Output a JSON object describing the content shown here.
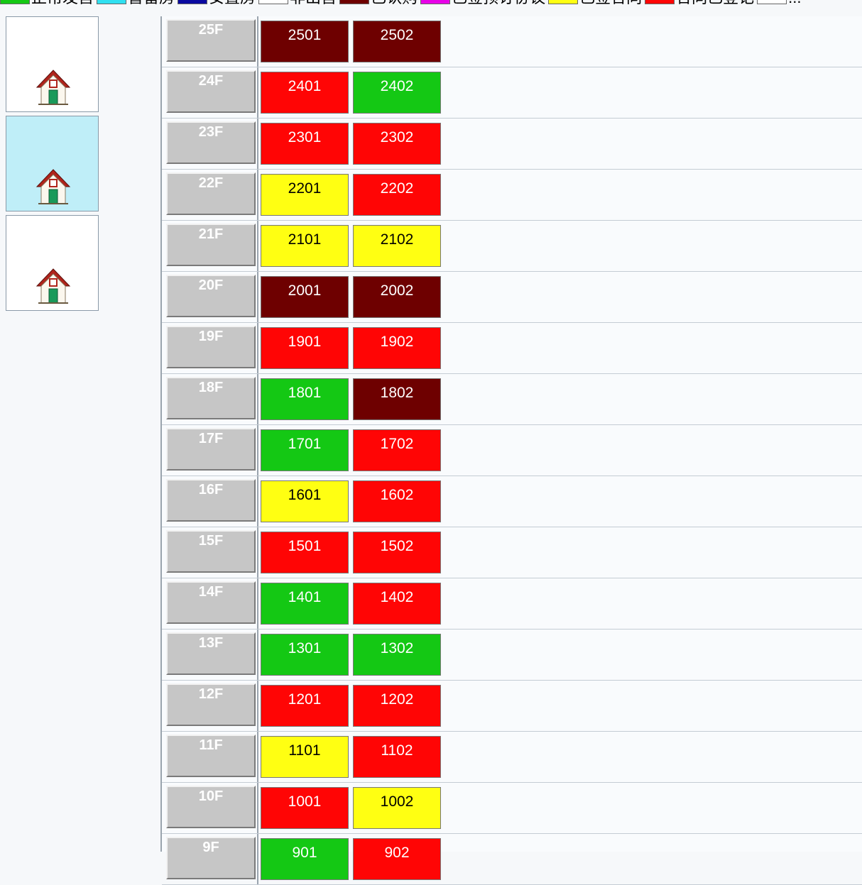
{
  "colors": {
    "maroon": "#6e0000",
    "red": "#ff0505",
    "green": "#14c814",
    "yellow": "#ffff12",
    "cyan": "#30e0f0",
    "navy": "#0a0aa0",
    "white": "#ffffff",
    "magenta": "#e800e8",
    "label_bg": "#c6c6c6"
  },
  "legend": [
    {
      "label": "正常发售",
      "color": "green"
    },
    {
      "label": "暂留房",
      "color": "cyan"
    },
    {
      "label": "安置房",
      "color": "navy"
    },
    {
      "label": "非出售",
      "color": "white"
    },
    {
      "label": "已认购",
      "color": "maroon"
    },
    {
      "label": "已签预订协议",
      "color": "magenta"
    },
    {
      "label": "已签合同",
      "color": "yellow"
    },
    {
      "label": "合同已登记",
      "color": "red"
    },
    {
      "label": "...",
      "color": "white"
    }
  ],
  "buildings": [
    {
      "icon": "house-icon",
      "selected": false
    },
    {
      "icon": "house-icon",
      "selected": true
    },
    {
      "icon": "house-icon",
      "selected": false
    }
  ],
  "floors": [
    {
      "label": "25F",
      "units": [
        {
          "no": "2501",
          "status": "maroon"
        },
        {
          "no": "2502",
          "status": "maroon"
        }
      ]
    },
    {
      "label": "24F",
      "units": [
        {
          "no": "2401",
          "status": "red"
        },
        {
          "no": "2402",
          "status": "green"
        }
      ]
    },
    {
      "label": "23F",
      "units": [
        {
          "no": "2301",
          "status": "red"
        },
        {
          "no": "2302",
          "status": "red"
        }
      ]
    },
    {
      "label": "22F",
      "units": [
        {
          "no": "2201",
          "status": "yellow"
        },
        {
          "no": "2202",
          "status": "red"
        }
      ]
    },
    {
      "label": "21F",
      "units": [
        {
          "no": "2101",
          "status": "yellow"
        },
        {
          "no": "2102",
          "status": "yellow"
        }
      ]
    },
    {
      "label": "20F",
      "units": [
        {
          "no": "2001",
          "status": "maroon"
        },
        {
          "no": "2002",
          "status": "maroon"
        }
      ]
    },
    {
      "label": "19F",
      "units": [
        {
          "no": "1901",
          "status": "red"
        },
        {
          "no": "1902",
          "status": "red"
        }
      ]
    },
    {
      "label": "18F",
      "units": [
        {
          "no": "1801",
          "status": "green"
        },
        {
          "no": "1802",
          "status": "maroon"
        }
      ]
    },
    {
      "label": "17F",
      "units": [
        {
          "no": "1701",
          "status": "green"
        },
        {
          "no": "1702",
          "status": "red"
        }
      ]
    },
    {
      "label": "16F",
      "units": [
        {
          "no": "1601",
          "status": "yellow"
        },
        {
          "no": "1602",
          "status": "red"
        }
      ]
    },
    {
      "label": "15F",
      "units": [
        {
          "no": "1501",
          "status": "red"
        },
        {
          "no": "1502",
          "status": "red"
        }
      ]
    },
    {
      "label": "14F",
      "units": [
        {
          "no": "1401",
          "status": "green"
        },
        {
          "no": "1402",
          "status": "red"
        }
      ]
    },
    {
      "label": "13F",
      "units": [
        {
          "no": "1301",
          "status": "green"
        },
        {
          "no": "1302",
          "status": "green"
        }
      ]
    },
    {
      "label": "12F",
      "units": [
        {
          "no": "1201",
          "status": "red"
        },
        {
          "no": "1202",
          "status": "red"
        }
      ]
    },
    {
      "label": "11F",
      "units": [
        {
          "no": "1101",
          "status": "yellow"
        },
        {
          "no": "1102",
          "status": "red"
        }
      ]
    },
    {
      "label": "10F",
      "units": [
        {
          "no": "1001",
          "status": "red"
        },
        {
          "no": "1002",
          "status": "yellow"
        }
      ]
    },
    {
      "label": "9F",
      "units": [
        {
          "no": "901",
          "status": "green"
        },
        {
          "no": "902",
          "status": "red"
        }
      ]
    }
  ]
}
